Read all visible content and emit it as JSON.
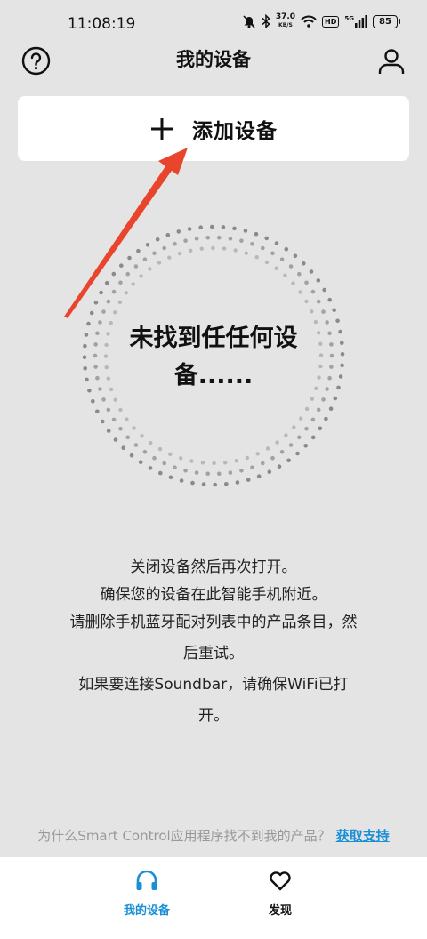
{
  "status_bar": {
    "time": "11:08:19",
    "net_speed": "37.0",
    "net_unit": "KB/S",
    "hd": "HD",
    "net_type": "5G",
    "battery": "85"
  },
  "header": {
    "title": "我的设备"
  },
  "add_device": {
    "label": "添加设备"
  },
  "scan": {
    "empty_line1": "未找到任任何设",
    "empty_line2": "备......"
  },
  "tips": [
    "关闭设备然后再次打开。",
    "确保您的设备在此智能手机附近。",
    "请删除手机蓝牙配对列表中的产品条目，然",
    "后重试。",
    "如果要连接Soundbar，请确保WiFi已打",
    "开。"
  ],
  "help": {
    "question": "为什么Smart Control应用程序找不到我的产品？",
    "link": "获取支持"
  },
  "tabbar": {
    "tabs": [
      {
        "label": "我的设备",
        "icon": "headphones-icon",
        "active": true
      },
      {
        "label": "发现",
        "icon": "heart-icon",
        "active": false
      }
    ]
  },
  "colors": {
    "accent": "#1a8fd6",
    "background": "#e4e4e4",
    "arrow": "#e8452c"
  }
}
